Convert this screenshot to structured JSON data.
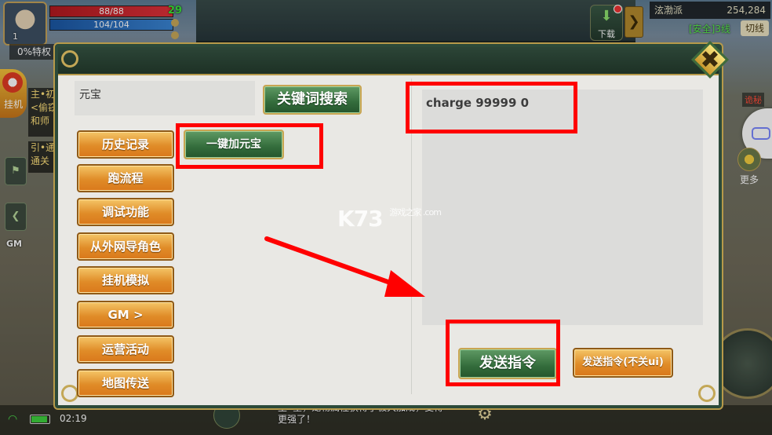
{
  "hud": {
    "player_level": "1",
    "hp": "88/88",
    "mp": "104/104",
    "green_value": "29",
    "privilege": "0%特权",
    "download_label": "下载",
    "map_name": "泫渤派",
    "gold_amount": "254,284",
    "safe_line": "[安全]3线",
    "switch_label": "切线",
    "hook_label": "挂机",
    "quest_main": "主•初\n<偷窃\n和师",
    "quest_guide": "引•通\n通关",
    "gm_label": "GM",
    "warning_tag": "诡秘",
    "more_label": "更多",
    "time": "02:19",
    "chat_line1": "主•星，宠物属性获得了极大加成，变得",
    "chat_line2": "更强了！"
  },
  "panel": {
    "input_value": "元宝",
    "search_button": "关键词搜索",
    "command_text": "charge 99999 0",
    "menu": [
      "历史记录",
      "跑流程",
      "调试功能",
      "从外网导角色",
      "挂机模拟",
      "GM >",
      "运营活动",
      "地图传送"
    ],
    "add_yuanbao_button": "一键加元宝",
    "send_button": "发送指令",
    "send_keep_button": "发送指令(不关ui)",
    "close_glyph": "✖"
  },
  "watermark": {
    "main": "K73",
    "sub": "游戏之家 .com"
  },
  "colors": {
    "highlight": "#ff0000",
    "panel_frame": "#2c4a3a",
    "gold_button": "#e08c28",
    "green_button": "#336c3b"
  }
}
